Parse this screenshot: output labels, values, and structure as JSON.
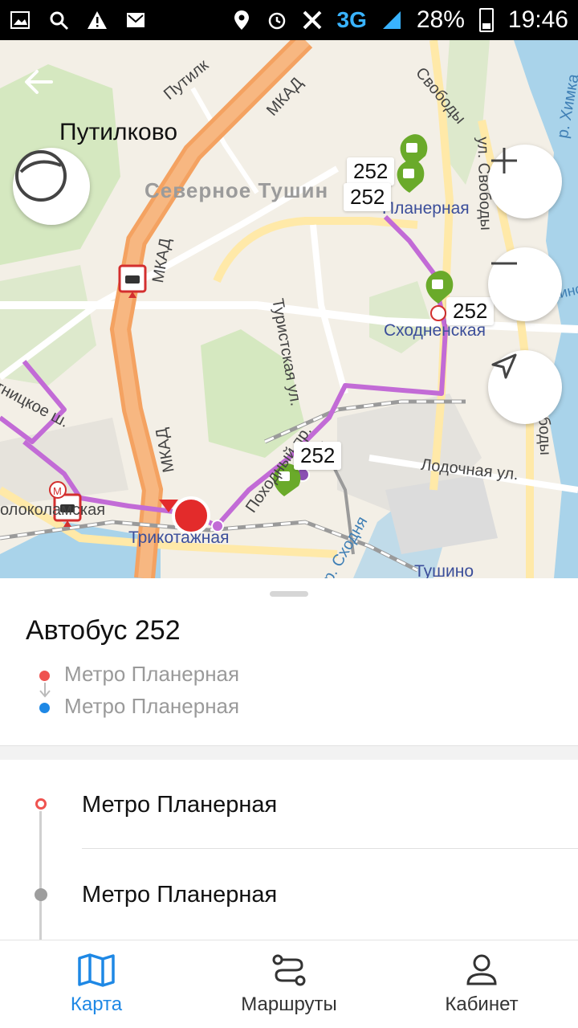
{
  "status_bar": {
    "time": "19:46",
    "battery": "28%",
    "network": "3G"
  },
  "map": {
    "labels": {
      "putilkovo": "Путилково",
      "district": "Северное Тушин",
      "planernaya": "Планерная",
      "skhodnenskaya": "Сходненская",
      "turistskaya": "Туристская ул.",
      "mkad_top": "МКАД",
      "mkad_left": "МКАД",
      "mkad_bottom": "МКАД",
      "lodochnaya": "Лодочная ул.",
      "tushino": "Тушино",
      "trikotazhnaya": "Трикотажная",
      "volokolamskaya": "олоколамская",
      "pyatnitskoe": "тницкое ш.",
      "svobody": "ул. Свободы",
      "svobody2": "ул. Свободы",
      "skhodnya": "р. Сходня",
      "putilkovskoe": "Путилк",
      "pokhodny": "Походный пр.",
      "khimki": "Химкинское вдх",
      "khimka": "р. Химка",
      "svobody_top": "Свободы"
    },
    "route_badges": [
      "252",
      "252",
      "252",
      "252"
    ]
  },
  "sheet": {
    "title": "Автобус 252",
    "from": "Метро Планерная",
    "to": "Метро Планерная",
    "stops": [
      "Метро Планерная",
      "Метро Планерная"
    ]
  },
  "nav": {
    "map": "Карта",
    "routes": "Маршруты",
    "cabinet": "Кабинет"
  },
  "colors": {
    "accent": "#1e88e5",
    "route": "#c26bd6",
    "stop_marker": "#6aaa2a",
    "start_marker": "#ef5350"
  }
}
